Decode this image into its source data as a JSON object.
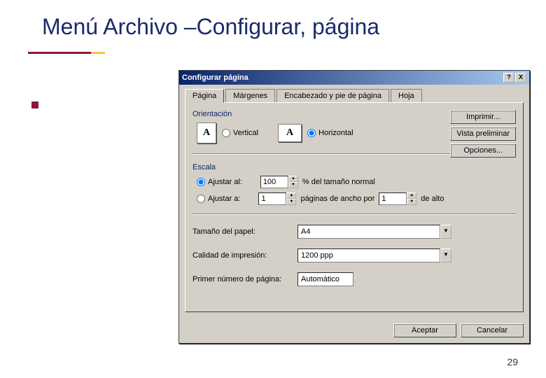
{
  "slide": {
    "title": "Menú Archivo –Configurar, página",
    "page_number": "29"
  },
  "dialog": {
    "title": "Configurar página",
    "help_btn": "?",
    "close_btn": "X",
    "tabs": {
      "pagina": "Página",
      "margenes": "Márgenes",
      "encabezado": "Encabezado y pie de página",
      "hoja": "Hoja"
    },
    "buttons": {
      "imprimir": "Imprimir...",
      "vista": "Vista preliminar",
      "opciones": "Opciones...",
      "aceptar": "Aceptar",
      "cancelar": "Cancelar"
    },
    "orientacion": {
      "label": "Orientación",
      "vertical": "Vertical",
      "horizontal": "Horizontal",
      "icon_letter": "A"
    },
    "escala": {
      "label": "Escala",
      "ajustar_al": "Ajustar al:",
      "ajustar_al_value": "100",
      "ajustar_al_suffix": "% del tamaño normal",
      "ajustar_a": "Ajustar a:",
      "ancho_value": "1",
      "ancho_suffix": "páginas de ancho por",
      "alto_value": "1",
      "alto_suffix": "de alto"
    },
    "paper": {
      "size_label": "Tamaño del papel:",
      "size_value": "A4",
      "quality_label": "Calidad de impresión:",
      "quality_value": "1200 ppp",
      "first_page_label": "Primer número de página:",
      "first_page_value": "Automático"
    }
  }
}
